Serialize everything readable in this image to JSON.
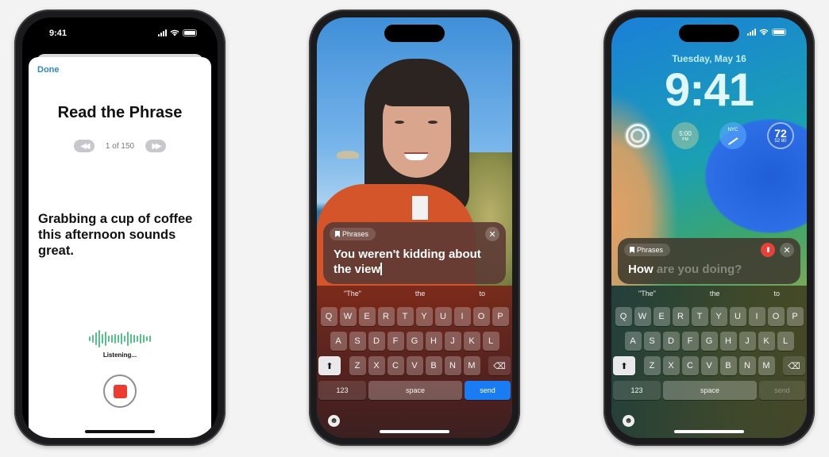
{
  "phone1": {
    "status_time": "9:41",
    "done_label": "Done",
    "title": "Read the Phrase",
    "prev_icon": "◀◀",
    "next_icon": "▶▶",
    "page_counter": "1 of 150",
    "phrase": "Grabbing a cup of coffee this afternoon sounds great.",
    "listening_label": "Listening...",
    "accent_color": "#2f86c9",
    "record_color": "#ec3c30"
  },
  "phone2": {
    "phrases_chip": "Phrases",
    "close_icon": "✕",
    "typed_text": "You weren't kidding about the view",
    "suggestions": [
      "\"The\"",
      "the",
      "to"
    ],
    "keyboard": {
      "row1": [
        "Q",
        "W",
        "E",
        "R",
        "T",
        "Y",
        "U",
        "I",
        "O",
        "P"
      ],
      "row2": [
        "A",
        "S",
        "D",
        "F",
        "G",
        "H",
        "J",
        "K",
        "L"
      ],
      "row3": [
        "Z",
        "X",
        "C",
        "V",
        "B",
        "N",
        "M"
      ],
      "shift_icon": "⬆",
      "delete_icon": "⌫",
      "numbers_label": "123",
      "space_label": "space",
      "send_label": "send",
      "emoji_icon": "☻"
    },
    "send_color": "#1a7cf3"
  },
  "phone3": {
    "date": "Tuesday, May 16",
    "time": "9:41",
    "widgets": {
      "clock_label": "5:00",
      "clock_sub": "PM",
      "world_clock_label": "NYC",
      "temperature": "72",
      "temp_range": "52 80"
    },
    "phrases_chip": "Phrases",
    "pause_icon": "II",
    "close_icon": "✕",
    "spoken_text": "How",
    "pending_text": "are you doing?",
    "suggestions": [
      "\"The\"",
      "the",
      "to"
    ],
    "keyboard": {
      "row1": [
        "Q",
        "W",
        "E",
        "R",
        "T",
        "Y",
        "U",
        "I",
        "O",
        "P"
      ],
      "row2": [
        "A",
        "S",
        "D",
        "F",
        "G",
        "H",
        "J",
        "K",
        "L"
      ],
      "row3": [
        "Z",
        "X",
        "C",
        "V",
        "B",
        "N",
        "M"
      ],
      "shift_icon": "⬆",
      "delete_icon": "⌫",
      "numbers_label": "123",
      "space_label": "space",
      "send_label": "send",
      "emoji_icon": "☻"
    }
  }
}
